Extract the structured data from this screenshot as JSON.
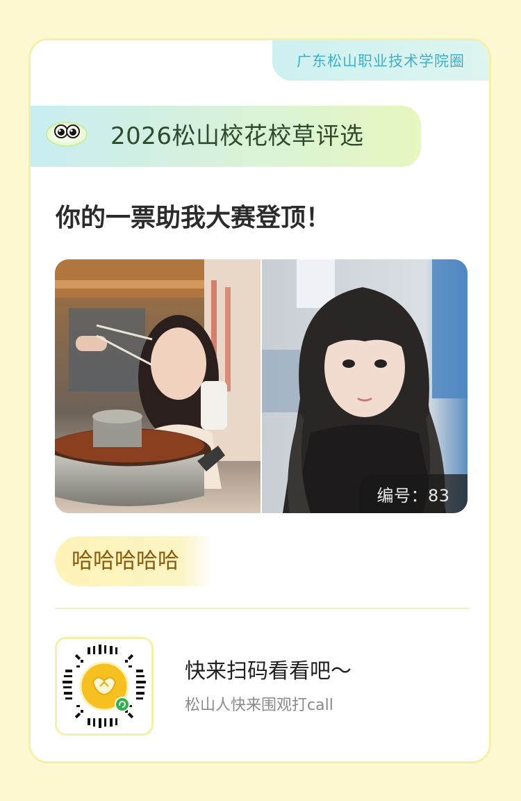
{
  "circle_tag": "广东松山职业技术学院圈",
  "banner": {
    "title": "2026松山校花校草评选",
    "mascot_icon": "eyes-mascot-icon"
  },
  "headline": "你的一票助我大赛登顶！",
  "photos": {
    "left_alt": "photo-contestant-hotpot",
    "right_alt": "photo-contestant-portrait",
    "number_label": "编号：83"
  },
  "nickname": "哈哈哈哈哈",
  "qr": {
    "icon": "mini-program-qr-code-icon"
  },
  "cta": {
    "title": "快来扫码看看吧～",
    "subtitle": "松山人快来围观打call"
  },
  "colors": {
    "page_bg": "#fcf8d2",
    "card_border": "#f4f0a8",
    "tag_text": "#3cb1c9",
    "nickname_text": "#8c5a08"
  }
}
